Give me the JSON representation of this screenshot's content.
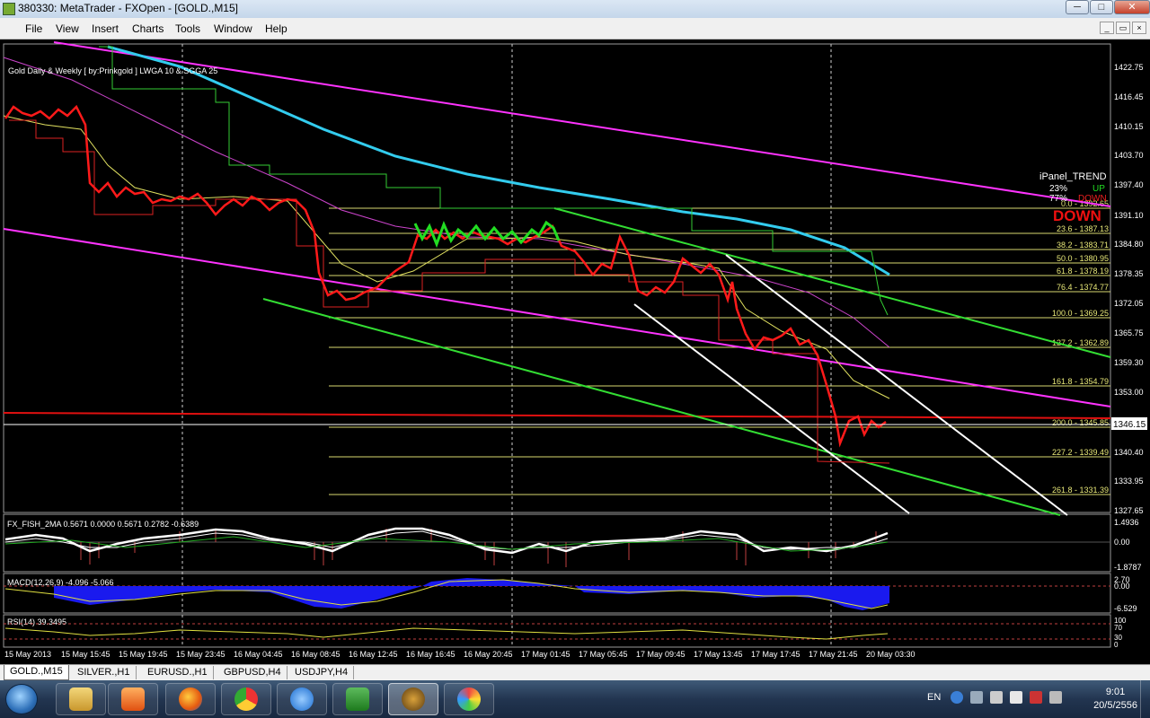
{
  "window": {
    "title": "380330: MetaTrader - FXOpen - [GOLD.,M15]",
    "minimize": "─",
    "maximize": "□",
    "close": "✕"
  },
  "menu": [
    "File",
    "View",
    "Insert",
    "Charts",
    "Tools",
    "Window",
    "Help"
  ],
  "mdi_buttons": [
    "_",
    "▭",
    "×"
  ],
  "chart": {
    "caption": "Gold Daily & Weekly [ by:Prinkgold ]  LWGA 10  &  SGGA 25",
    "current_price": "1346.15",
    "price_scale": [
      "1422.75",
      "1416.45",
      "1410.15",
      "1403.70",
      "1397.40",
      "1391.10",
      "1384.80",
      "1378.35",
      "1372.05",
      "1365.75",
      "1359.30",
      "1353.00",
      "1340.40",
      "1333.95",
      "1327.65"
    ],
    "fib_levels": [
      "0.0 - 1392.65",
      "23.6 - 1387.13",
      "38.2 - 1383.71",
      "50.0 - 1380.95",
      "61.8 - 1378.19",
      "76.4 - 1374.77",
      "100.0 - 1369.25",
      "127.2 - 1362.89",
      "161.8 - 1354.79",
      "200.0 - 1345.85",
      "227.2 - 1339.49",
      "261.8 - 1331.39"
    ],
    "ipanel": {
      "title": "iPanel_TREND",
      "up_pct": "23%",
      "up_label": "UP",
      "down_pct": "77%",
      "down_label": "DOWN",
      "big_label": "DOWN"
    },
    "time_axis": [
      "15 May 2013",
      "15 May 15:45",
      "15 May 19:45",
      "15 May 23:45",
      "16 May 04:45",
      "16 May 08:45",
      "16 May 12:45",
      "16 May 16:45",
      "16 May 20:45",
      "17 May 01:45",
      "17 May 05:45",
      "17 May 09:45",
      "17 May 13:45",
      "17 May 17:45",
      "17 May 21:45",
      "20 May 03:30"
    ]
  },
  "fisher": {
    "label": "FX_FISH_2MA 0.5671 0.0000 0.5671 0.2782 -0.6389",
    "scale": [
      "1.4936",
      "0.00",
      "-1.8787"
    ]
  },
  "macd": {
    "label": "MACD(12,26,9) -4.096 -5.066",
    "scale": [
      "2.70",
      "0.00",
      "-6.529"
    ]
  },
  "rsi": {
    "label": "RSI(14) 39.3495",
    "scale": [
      "100",
      "70",
      "30",
      "0"
    ]
  },
  "tabs": [
    "GOLD.,M15",
    "SILVER.,H1",
    "EURUSD.,H1",
    "GBPUSD,H4",
    "USDJPY,H4"
  ],
  "taskbar": {
    "apps": [
      "windows-explorer",
      "media-player",
      "firefox",
      "chrome",
      "internet-explorer",
      "excel",
      "metatrader",
      "paint"
    ],
    "language": "EN",
    "time": "9:01",
    "date": "20/5/2556"
  }
}
